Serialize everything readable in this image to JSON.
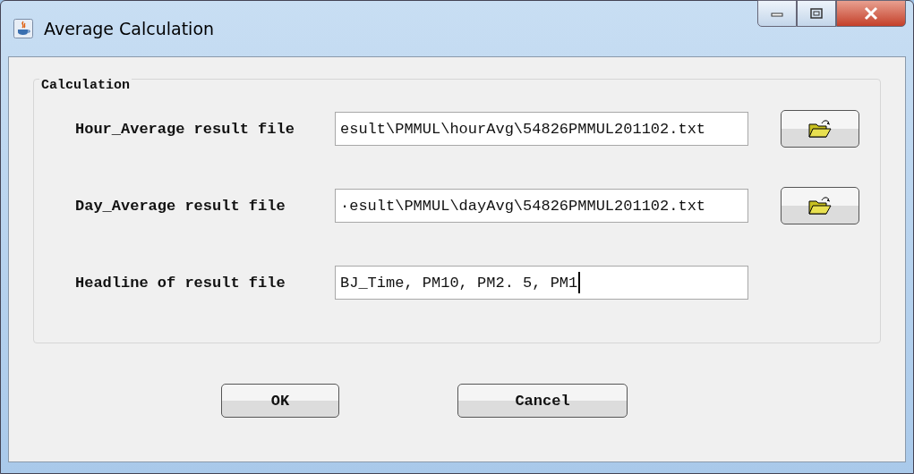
{
  "window": {
    "title": "Average Calculation"
  },
  "group": {
    "title": "Calculation",
    "rows": [
      {
        "label": "Hour_Average result file",
        "value": "esult\\PMMUL\\hourAvg\\54826PMMUL201102.txt",
        "focused": false,
        "browse": true
      },
      {
        "label": "Day_Average result file",
        "value": "·esult\\PMMUL\\dayAvg\\54826PMMUL201102.txt",
        "focused": false,
        "browse": true
      },
      {
        "label": "Headline of result file",
        "value": "BJ_Time, PM10, PM2. 5, PM1",
        "focused": true,
        "browse": false
      }
    ]
  },
  "buttons": [
    "OK",
    "Cancel"
  ]
}
